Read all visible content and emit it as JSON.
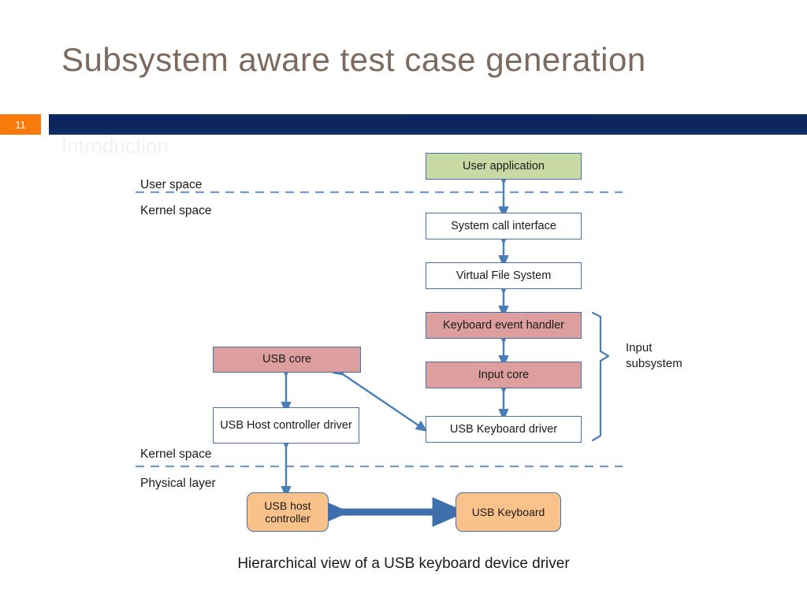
{
  "slide": {
    "title": "Subsystem aware test case generation",
    "number": "11",
    "ghost_subtitle": "Introduction",
    "caption": "Hierarchical view of a USB keyboard device driver"
  },
  "colors": {
    "title_text": "#7c6a5e",
    "header_bar": "#0a2359",
    "badge": "#f97a0c",
    "box_border": "#4472a8",
    "green_fill": "#c9d9a4",
    "pink_fill": "#dd9e9e",
    "orange_fill": "#f9c28a",
    "white_fill": "#ffffff",
    "arrow": "#4a7ebb",
    "thick_arrow": "#3f6fab",
    "dashed_divider": "#6f9ad3"
  },
  "diagram": {
    "boundary_labels": {
      "user_space": "User space",
      "kernel_space_top": "Kernel space",
      "kernel_space_bottom": "Kernel space",
      "physical_layer": "Physical layer"
    },
    "bracket_label": "Input\nsubsystem",
    "bracket_label_line1": "Input",
    "bracket_label_line2": "subsystem",
    "nodes": [
      {
        "id": "user-application",
        "label": "User application",
        "fill": "green"
      },
      {
        "id": "system-call-interface",
        "label": "System call interface",
        "fill": "white"
      },
      {
        "id": "virtual-file-system",
        "label": "Virtual File System",
        "fill": "white"
      },
      {
        "id": "keyboard-event-handler",
        "label": "Keyboard event handler",
        "fill": "pink"
      },
      {
        "id": "input-core",
        "label": "Input core",
        "fill": "pink"
      },
      {
        "id": "usb-keyboard-driver",
        "label": "USB Keyboard driver",
        "fill": "white"
      },
      {
        "id": "usb-core",
        "label": "USB core",
        "fill": "pink"
      },
      {
        "id": "usb-host-controller-driver",
        "label": "USB Host controller driver",
        "fill": "white"
      },
      {
        "id": "usb-host-controller",
        "label": "USB host controller",
        "fill": "orange"
      },
      {
        "id": "usb-keyboard",
        "label": "USB Keyboard",
        "fill": "orange"
      }
    ]
  }
}
